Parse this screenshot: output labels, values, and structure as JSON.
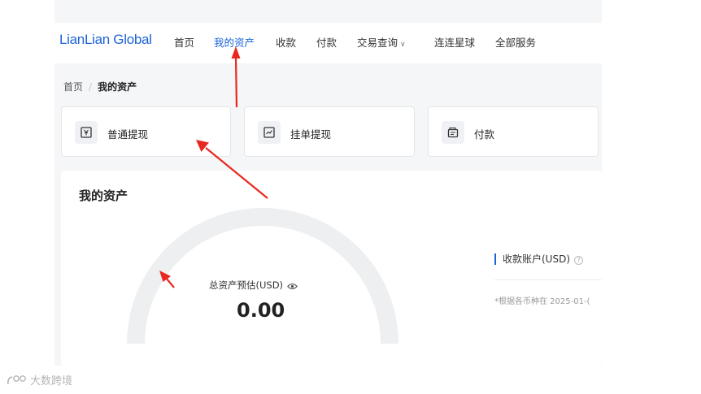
{
  "header": {
    "logo": "LianLian Global",
    "nav": [
      {
        "label": "首页"
      },
      {
        "label": "我的资产",
        "active": true
      },
      {
        "label": "收款"
      },
      {
        "label": "付款"
      },
      {
        "label": "交易查询",
        "has_dropdown": true
      },
      {
        "label": "连连星球"
      },
      {
        "label": "全部服务"
      }
    ]
  },
  "breadcrumb": {
    "home": "首页",
    "separator": "/",
    "current": "我的资产"
  },
  "actions": [
    {
      "label": "普通提现",
      "icon": "withdraw-icon"
    },
    {
      "label": "挂单提现",
      "icon": "order-withdraw-icon"
    },
    {
      "label": "付款",
      "icon": "payment-icon"
    }
  ],
  "assets": {
    "title": "我的资产",
    "total_label": "总资产预估(USD)",
    "total_value": "0.00",
    "account_label": "收款账户(USD)",
    "note": "*根据各币种在 2025-01-("
  },
  "watermark": "大数跨境",
  "colors": {
    "brand": "#1c63d8",
    "annotation_arrow": "#e8281e",
    "gauge_track": "#eeeff1"
  }
}
